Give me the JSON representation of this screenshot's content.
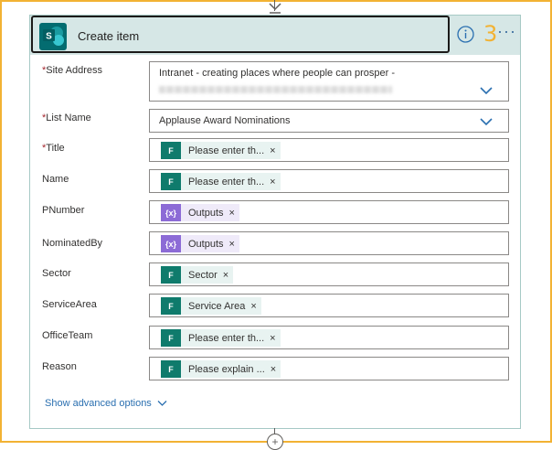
{
  "header": {
    "title": "Create item",
    "badge": "3",
    "more_label": "···"
  },
  "fields": [
    {
      "label": "Site Address",
      "required": true,
      "value": "Intranet - creating places where people can prosper -",
      "type": "dropdown"
    },
    {
      "label": "List Name",
      "required": true,
      "value": "Applause Award Nominations",
      "type": "dropdown"
    },
    {
      "label": "Title",
      "required": true,
      "token": "Please enter th...",
      "token_kind": "forms"
    },
    {
      "label": "Name",
      "required": false,
      "token": "Please enter th...",
      "token_kind": "forms"
    },
    {
      "label": "PNumber",
      "required": false,
      "token": "Outputs",
      "token_kind": "expression"
    },
    {
      "label": "NominatedBy",
      "required": false,
      "token": "Outputs",
      "token_kind": "expression"
    },
    {
      "label": "Sector",
      "required": false,
      "token": "Sector",
      "token_kind": "forms"
    },
    {
      "label": "ServiceArea",
      "required": false,
      "token": "Service Area",
      "token_kind": "forms"
    },
    {
      "label": "OfficeTeam",
      "required": false,
      "token": "Please enter th...",
      "token_kind": "forms"
    },
    {
      "label": "Reason",
      "required": false,
      "token": "Please explain ...",
      "token_kind": "forms"
    }
  ],
  "token_remove": "×",
  "required_mark": "*",
  "advanced_label": "Show advanced options",
  "colors": {
    "accent_frame": "#f2b233",
    "header_bg": "#d6e7e6",
    "forms_token": "#0f7b6c",
    "expression_token": "#8c6bd6",
    "link": "#2a6fb0"
  }
}
